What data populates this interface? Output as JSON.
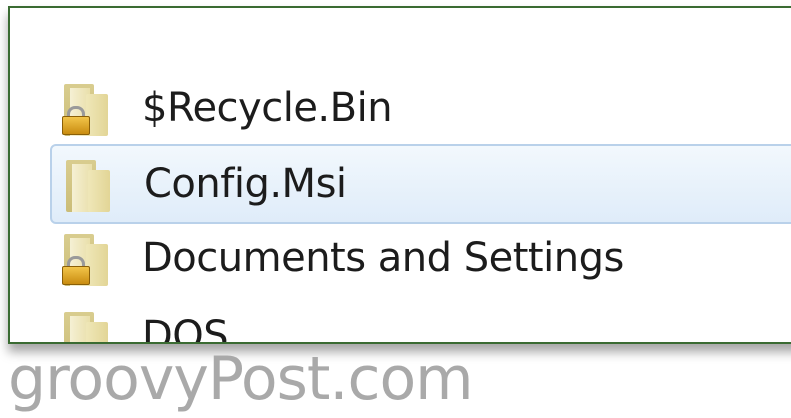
{
  "items": [
    {
      "label": "$Recycle.Bin",
      "icon": "folder-icon",
      "locked": true
    },
    {
      "label": "Config.Msi",
      "icon": "folder-icon",
      "locked": false,
      "selected": true
    },
    {
      "label": "Documents and Settings",
      "icon": "folder-icon",
      "locked": true
    },
    {
      "label": "DOS",
      "icon": "folder-icon",
      "locked": false
    }
  ],
  "watermark": "groovyPost.com",
  "colors": {
    "frame_border": "#3a6b32",
    "selection_fill": "#dfecf9",
    "selection_border": "#b9d1ea",
    "folder": "#e2d596",
    "lock": "#d9a51f",
    "watermark": "#a9a9a9"
  }
}
